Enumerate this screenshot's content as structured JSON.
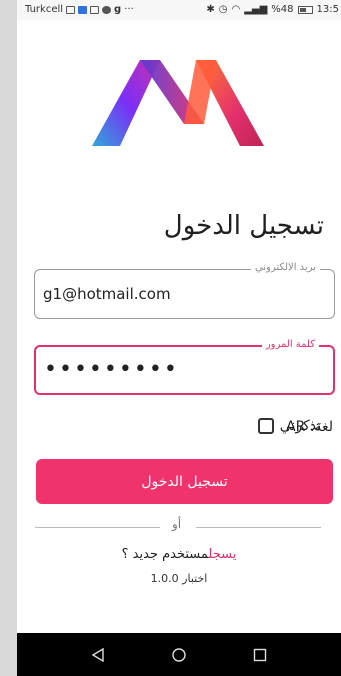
{
  "status_bar": {
    "carrier": "Turkcell",
    "indicator_text": "g",
    "ellipsis": "···",
    "signal_text": "%48",
    "time": "13:5"
  },
  "login": {
    "title": "تسجيل الدخول",
    "email": {
      "label": "بريد الالكتروني",
      "value": "g1@hotmail.com"
    },
    "password": {
      "label": "كلمة المرور",
      "masked_value": "•••••••••"
    },
    "remember_label": "تذكرني",
    "remember_checked": false,
    "language_label": "لغة",
    "language_value": "AR",
    "login_button": "تسجيل الدخول",
    "or_text": "أو",
    "new_user_text": "مستخدم جديد ؟",
    "register_link": "يسجل",
    "version_text": "اختبار 1.0.0"
  },
  "colors": {
    "accent": "#f0336d",
    "logo_gradient": [
      "#7b2ff7",
      "#e3306c",
      "#ff7a2f",
      "#2fa7d8"
    ]
  },
  "nav": {
    "icons": [
      "back-icon",
      "home-icon",
      "recents-icon"
    ]
  }
}
